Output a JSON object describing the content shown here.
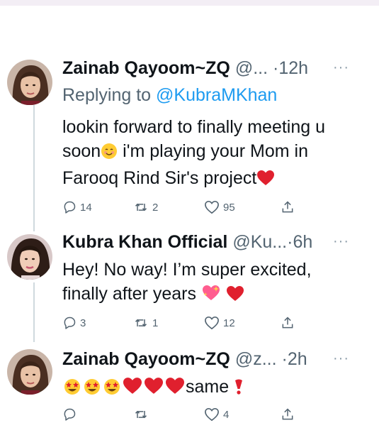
{
  "tweets": [
    {
      "name": "Zainab Qayoom~ZQ",
      "handle": "@...",
      "dot": "·",
      "time": "12h",
      "more": "···",
      "reply_prefix": "Replying to ",
      "reply_to": "@KubraMKhan",
      "line1": "lookin forward to finally meeting u",
      "line2a": "soon",
      "line2b": " i'm playing your Mom in",
      "line3": "Farooq Rind Sir's project",
      "replies": "14",
      "retweets": "2",
      "likes": "95"
    },
    {
      "name": "Kubra Khan Official",
      "handle": "@Ku...",
      "dot": "·",
      "time": "6h",
      "more": "···",
      "line1": "Hey! No way! I’m super excited,",
      "line2": "finally after years ",
      "replies": "3",
      "retweets": "1",
      "likes": "12"
    },
    {
      "name": "Zainab Qayoom~ZQ",
      "handle": "@z...",
      "dot": "·",
      "time": "2h",
      "more": "···",
      "line1": "same",
      "replies": "",
      "retweets": "",
      "likes": "4"
    }
  ],
  "colors": {
    "link": "#1d9bf0",
    "muted": "#536471",
    "heart": "#e0202e",
    "thread_line": "#cfd9de"
  },
  "icons": [
    "reply-icon",
    "retweet-icon",
    "like-icon",
    "share-icon",
    "smiling-face-emoji",
    "red-heart-emoji",
    "sparkling-heart-emoji",
    "star-struck-emoji",
    "exclamation-emoji"
  ]
}
